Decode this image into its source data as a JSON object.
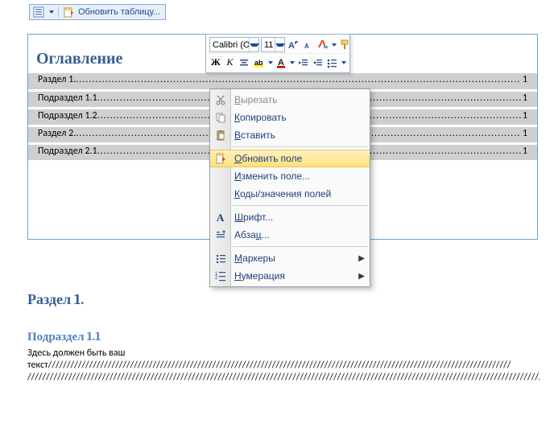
{
  "smarttag": {
    "update_label": "Обновить таблицу..."
  },
  "toc": {
    "title": "Оглавление",
    "rows": [
      {
        "title": "Раздел 1.",
        "page": "1",
        "indent": 0
      },
      {
        "title": "Подраздел 1.1",
        "page": "1",
        "indent": 1
      },
      {
        "title": "Подраздел 1.2",
        "page": "1",
        "indent": 1
      },
      {
        "title": "Раздел 2.",
        "page": "1",
        "indent": 0
      },
      {
        "title": "Подраздел 2.1",
        "page": "1",
        "indent": 1
      }
    ]
  },
  "mini_toolbar": {
    "font_name": "Calibri (Осн",
    "font_size": "11"
  },
  "context_menu": {
    "items": [
      {
        "id": "cut",
        "label": "Вырезать",
        "ul": 0,
        "icon": "scissors",
        "disabled": true
      },
      {
        "id": "copy",
        "label": "Копировать",
        "ul": 0,
        "icon": "copy"
      },
      {
        "id": "paste",
        "label": "Вставить",
        "ul": 0,
        "icon": "paste"
      },
      {
        "sep": true
      },
      {
        "id": "update",
        "label": "Обновить поле",
        "ul": 0,
        "icon": "update-page",
        "hot": true
      },
      {
        "id": "edit-field",
        "label": "Изменить поле...",
        "ul": 0
      },
      {
        "id": "codes",
        "label": "Коды/значения полей",
        "ul": 0
      },
      {
        "sep": true
      },
      {
        "id": "font",
        "label": "Шрифт...",
        "ul": 0,
        "icon": "letter-a"
      },
      {
        "id": "para",
        "label": "Абзац...",
        "ul": 4,
        "icon": "paragraph"
      },
      {
        "sep": true
      },
      {
        "id": "bullets",
        "label": "Маркеры",
        "ul": 0,
        "icon": "bullets",
        "submenu": true
      },
      {
        "id": "numbers",
        "label": "Нумерация",
        "ul": 0,
        "icon": "numbers",
        "submenu": true
      }
    ]
  },
  "body": {
    "heading1": "Раздел 1.",
    "heading2": "Подраздел 1.1",
    "text_intro": "Здесь должен быть ваш ",
    "filler_line": "текст////////////////////////////////////////////////////////////////////////////////////////////////////////////////////////////",
    "filler_rest": "////////////////////////////////////////////////////////////////////////////////////////////////////////////////////////////////////////////////////////////////////////////////////////////////////////////////////////////////////////////////////////////////"
  },
  "leader_dots": "........................................................................................................................................................................"
}
